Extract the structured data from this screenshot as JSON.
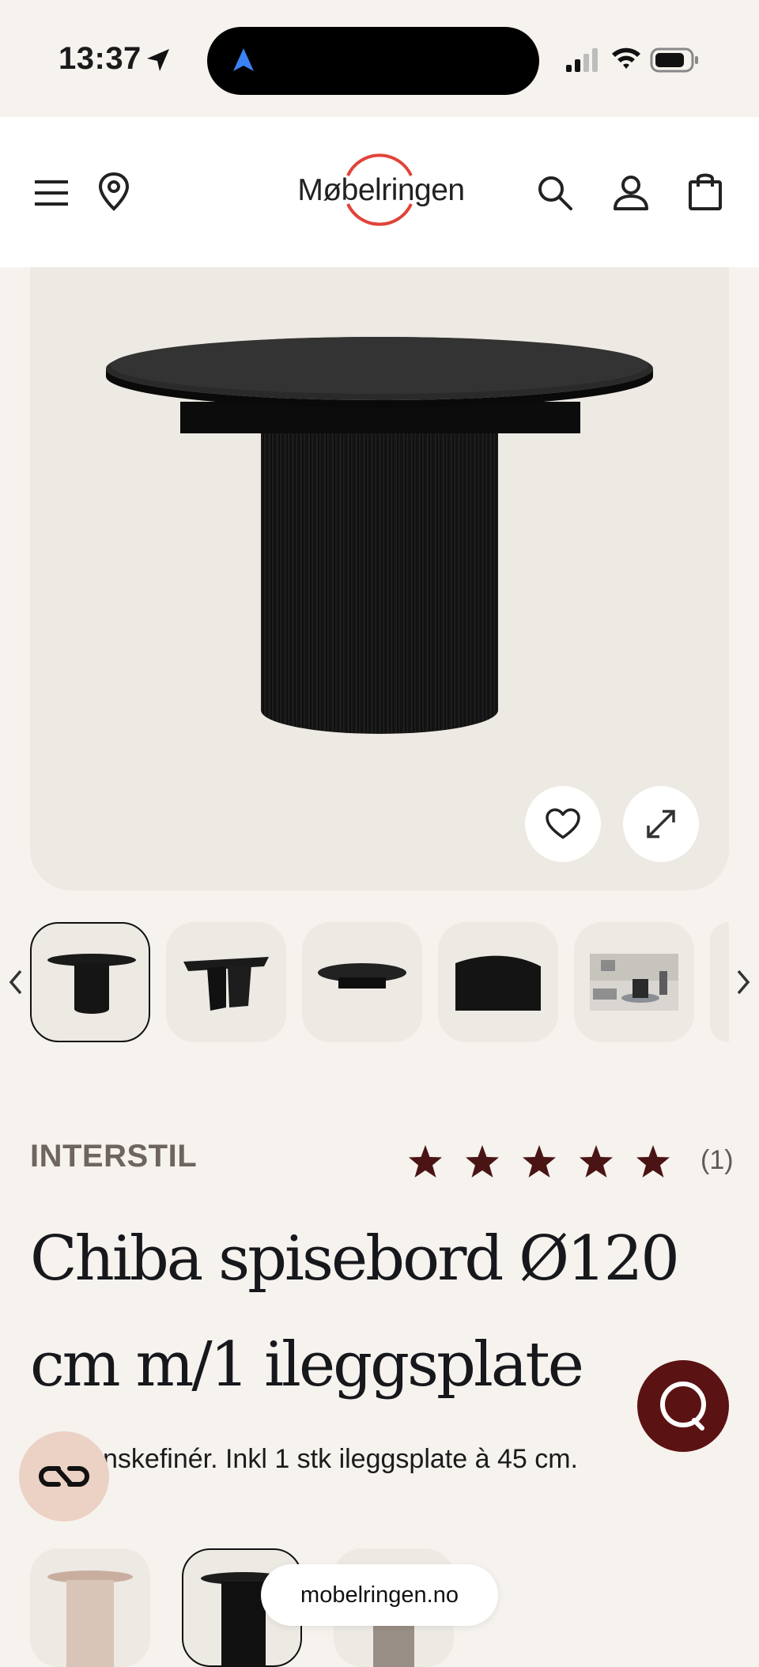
{
  "status_bar": {
    "time": "13:37"
  },
  "header": {
    "logo_text": "Møbelringen",
    "icons": [
      "menu-icon",
      "location-pin-icon",
      "search-icon",
      "account-icon",
      "shopping-bag-icon"
    ]
  },
  "product": {
    "brand": "INTERSTIL",
    "rating": {
      "stars": 5,
      "count_label": "(1)"
    },
    "title": "Chiba spisebord Ø120 cm m/1 ileggsplate",
    "description_visible": "nskefinér. Inkl 1 stk ileggsplate à 45 cm."
  },
  "gallery": {
    "thumbnail_count_visible": 6,
    "selected_index": 0
  },
  "colors": {
    "background": "#f6f2ee",
    "image_bg": "#ede9e3",
    "logo_red": "#e0443a",
    "star": "#4a1414",
    "chat_button": "#5b1212",
    "ai_button": "#ecd2c4"
  },
  "browser": {
    "url": "mobelringen.no"
  }
}
